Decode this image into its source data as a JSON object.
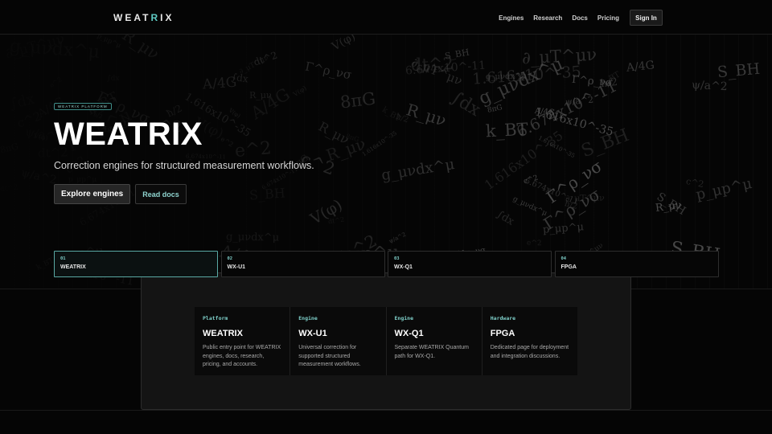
{
  "header": {
    "logo_pre": "WEAT",
    "logo_x": "R",
    "logo_post": "IX",
    "nav": [
      "Engines",
      "Research",
      "Docs",
      "Pricing"
    ],
    "signin_label": "Sign In"
  },
  "hero": {
    "badge": "WEATRIX PLATFORM",
    "title": "WEATRIX",
    "subtitle": "Correction engines for structured measurement workflows.",
    "cta_primary": "Explore engines",
    "cta_secondary": "Read docs"
  },
  "tabs": [
    {
      "num": "01",
      "label": "WEATRIX",
      "active": true
    },
    {
      "num": "02",
      "label": "WX-U1",
      "active": false
    },
    {
      "num": "03",
      "label": "WX-Q1",
      "active": false
    },
    {
      "num": "04",
      "label": "FPGA",
      "active": false
    }
  ],
  "cards": [
    {
      "tag": "Platform",
      "title": "WEATRIX",
      "desc": "Public entry point for WEATRIX engines, docs, research, pricing, and accounts."
    },
    {
      "tag": "Engine",
      "title": "WX-U1",
      "desc": "Universal correction for supported structured measurement workflows."
    },
    {
      "tag": "Engine",
      "title": "WX-Q1",
      "desc": "Separate WEATRIX Quantum path for WX-Q1."
    },
    {
      "tag": "Hardware",
      "title": "FPGA",
      "desc": "Dedicated page for deployment and integration discussions."
    }
  ],
  "background_formulas": [
    "6.674x10^-11",
    "p_μp^μ",
    "∂_μT^μν",
    "g_μνdx^μ",
    "k_BT",
    "ψ/a^2",
    "A/4G",
    "ħ/2",
    "dt^2",
    "8πG",
    "1.616x10^-35",
    "V(φ)",
    "e^2",
    "R_μν",
    "Γ^ρ_νσ",
    "S_BH",
    "c^2",
    "∫dx"
  ],
  "colors": {
    "accent": "#5ec9c2",
    "background": "#050505",
    "panel": "#141414",
    "card": "#0a0a0a"
  }
}
